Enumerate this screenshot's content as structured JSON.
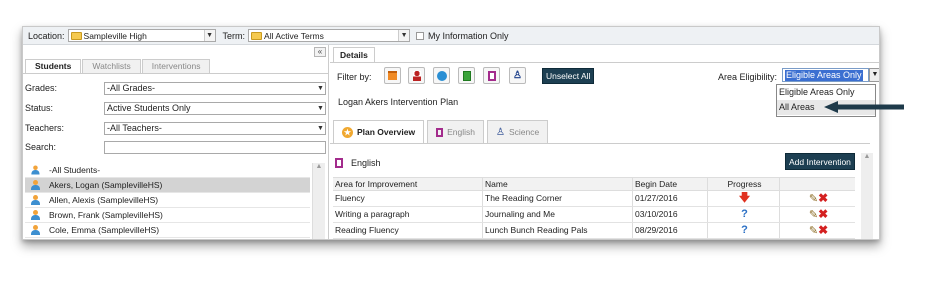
{
  "topbar": {
    "location_label": "Location:",
    "location_value": "Sampleville High",
    "term_label": "Term:",
    "term_value": "All Active Terms",
    "my_info_label": "My Information Only"
  },
  "left": {
    "collapse_glyph": "«",
    "tabs": [
      "Students",
      "Watchlists",
      "Interventions"
    ],
    "filters": {
      "grades_label": "Grades:",
      "grades_value": "-All Grades-",
      "status_label": "Status:",
      "status_value": "Active Students Only",
      "teachers_label": "Teachers:",
      "teachers_value": "-All Teachers-",
      "search_label": "Search:"
    },
    "students": [
      "-All Students-",
      "Akers, Logan (SamplevilleHS)",
      "Allen, Alexis (SamplevilleHS)",
      "Brown, Frank (SamplevilleHS)",
      "Cole, Emma (SamplevilleHS)"
    ]
  },
  "right": {
    "details_tab": "Details",
    "filter_by": "Filter by:",
    "unselect_all": "Unselect All",
    "area_eligibility_label": "Area Eligibility:",
    "area_eligibility_value": "Eligible Areas Only",
    "dropdown_options": [
      "Eligible Areas Only",
      "All Areas"
    ],
    "plan_title": "Logan Akers Intervention Plan",
    "plan_tabs": [
      "Plan Overview",
      "English",
      "Science"
    ],
    "section_title": "English",
    "add_intervention": "Add Intervention",
    "columns": [
      "Area for Improvement",
      "Name",
      "Begin Date",
      "Progress",
      ""
    ],
    "rows": [
      {
        "area": "Fluency",
        "name": "The Reading Corner",
        "date": "01/27/2016",
        "progress": "down-arrow"
      },
      {
        "area": "Writing a paragraph",
        "name": "Journaling and Me",
        "date": "03/10/2016",
        "progress": "?"
      },
      {
        "area": "Reading Fluency",
        "name": "Lunch Bunch Reading Pals",
        "date": "08/29/2016",
        "progress": "?"
      }
    ]
  },
  "colors": {
    "accent_button": "#1d3f52",
    "progress_down": "#e0311f",
    "progress_unknown": "#2a6fc4",
    "delete": "#d42020"
  }
}
